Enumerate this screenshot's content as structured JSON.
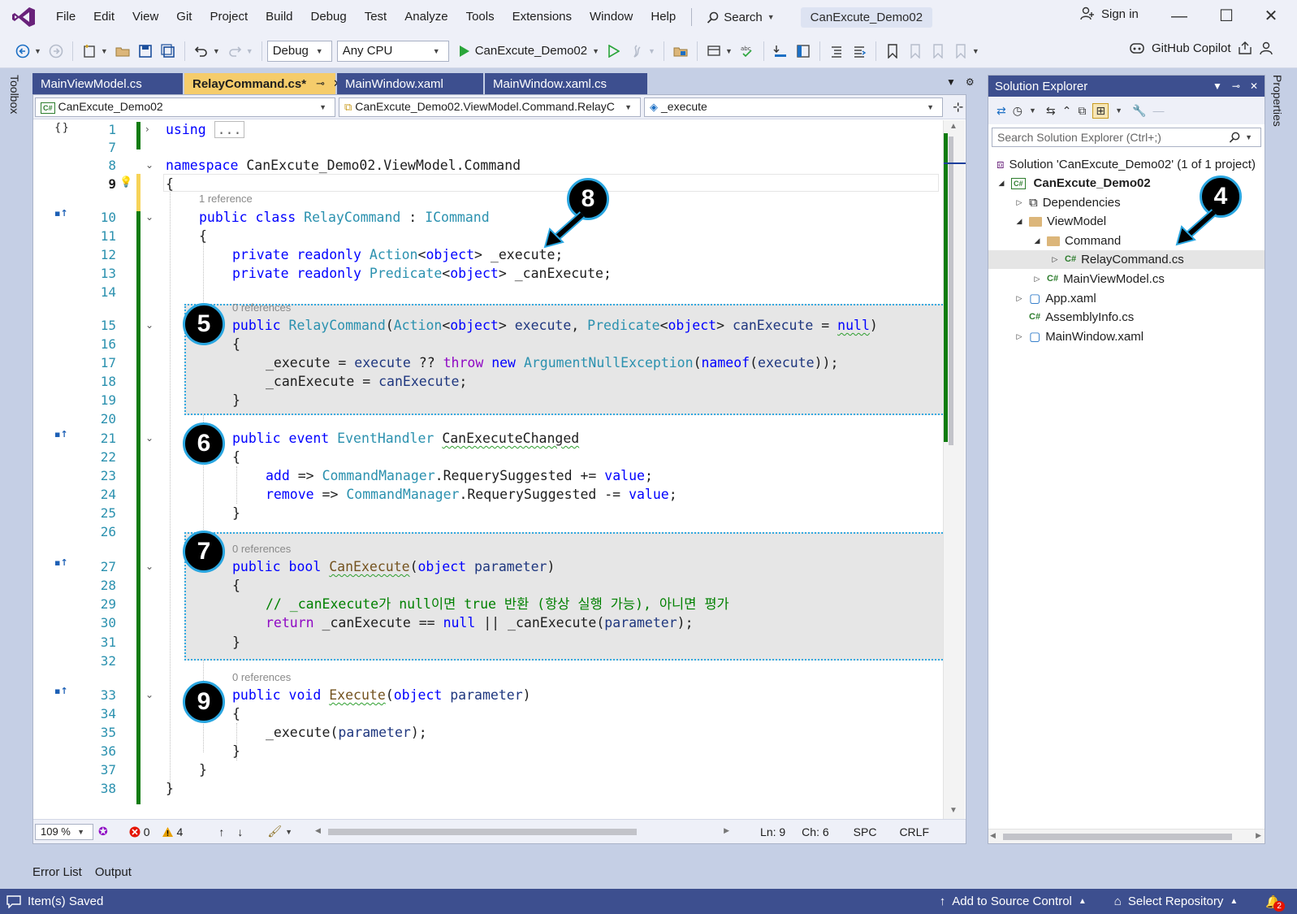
{
  "menu": {
    "items": [
      "File",
      "Edit",
      "View",
      "Git",
      "Project",
      "Build",
      "Debug",
      "Test",
      "Analyze",
      "Tools",
      "Extensions",
      "Window",
      "Help"
    ],
    "search_label": "Search",
    "title_tab": "CanExcute_Demo02",
    "sign_in": "Sign in"
  },
  "toolbar": {
    "config": "Debug",
    "platform": "Any CPU",
    "start_target": "CanExcute_Demo02",
    "copilot": "GitHub Copilot"
  },
  "side_labels": {
    "toolbox": "Toolbox",
    "properties": "Properties"
  },
  "tabs": [
    {
      "label": "MainViewModel.cs"
    },
    {
      "label": "RelayCommand.cs*"
    },
    {
      "label": "MainWindow.xaml"
    },
    {
      "label": "MainWindow.xaml.cs"
    }
  ],
  "navbar": {
    "project": "CanExcute_Demo02",
    "type": "CanExcute_Demo02.ViewModel.Command.RelayC",
    "member": "_execute"
  },
  "code": {
    "lines": {
      "l1": "1",
      "l7": "7",
      "l8": "8",
      "l9": "9",
      "l10": "10",
      "l11": "11",
      "l12": "12",
      "l13": "13",
      "l14": "14",
      "l15": "15",
      "l16": "16",
      "l17": "17",
      "l18": "18",
      "l19": "19",
      "l20": "20",
      "l21": "21",
      "l22": "22",
      "l23": "23",
      "l24": "24",
      "l25": "25",
      "l26": "26",
      "l27": "27",
      "l28": "28",
      "l29": "29",
      "l30": "30",
      "l31": "31",
      "l32": "32",
      "l33": "33",
      "l34": "34",
      "l35": "35",
      "l36": "36",
      "l37": "37",
      "l38": "38"
    },
    "using_kw": "using",
    "using_ellipsis": "...",
    "namespace_kw": "namespace",
    "namespace_name": "CanExcute_Demo02.ViewModel.Command",
    "ref_1": "1 reference",
    "ref_0": "0 references",
    "class_kw": "public class",
    "class_name": "RelayCommand",
    "class_sep": " : ",
    "interface_name": "ICommand",
    "comment_korean": "// _canExecute가 null이면 true 반환 (항상 실행 가능), 아니면 평가"
  },
  "callouts": {
    "c4": "4",
    "c5": "5",
    "c6": "6",
    "c7": "7",
    "c8": "8",
    "c9": "9"
  },
  "editor_status": {
    "zoom": "109 %",
    "errors": "0",
    "warnings": "4",
    "line": "Ln: 9",
    "col": "Ch: 6",
    "spacing": "SPC",
    "eol": "CRLF"
  },
  "solution_explorer": {
    "title": "Solution Explorer",
    "search_placeholder": "Search Solution Explorer (Ctrl+;)",
    "items": [
      {
        "label": "Solution 'CanExcute_Demo02' (1 of 1 project)"
      },
      {
        "label": "CanExcute_Demo02"
      },
      {
        "label": "Dependencies"
      },
      {
        "label": "ViewModel"
      },
      {
        "label": "Command"
      },
      {
        "label": "RelayCommand.cs"
      },
      {
        "label": "MainViewModel.cs"
      },
      {
        "label": "App.xaml"
      },
      {
        "label": "AssemblyInfo.cs"
      },
      {
        "label": "MainWindow.xaml"
      }
    ]
  },
  "bottom_tabs": [
    "Error List",
    "Output"
  ],
  "statusbar": {
    "saved": "Item(s) Saved",
    "source_control": "Add to Source Control",
    "repository": "Select Repository",
    "notifications": "2"
  },
  "colors": {
    "accent": "#3d4f8f",
    "active_tab": "#f5cc6b",
    "callout_border": "#2aa6e0",
    "highlight_border": "#32a9e0",
    "change_bar": "#107c10"
  }
}
